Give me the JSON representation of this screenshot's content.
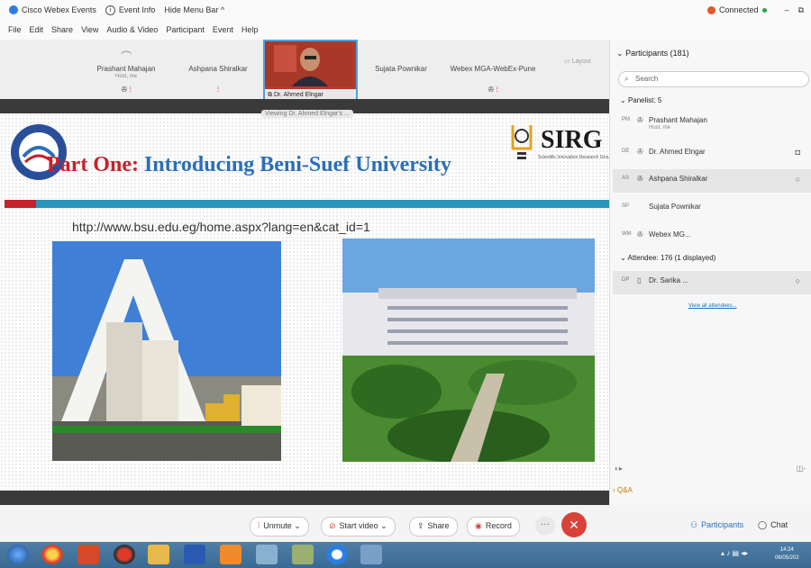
{
  "window": {
    "app_title": "Cisco Webex Events",
    "event_info": "Event Info",
    "hide_menu": "Hide Menu Bar ^",
    "connected": "Connected",
    "min": "–",
    "restore": "⧉"
  },
  "menu": [
    "File",
    "Edit",
    "Share",
    "View",
    "Audio & Video",
    "Participant",
    "Event",
    "Help"
  ],
  "video_strip": {
    "tiles": [
      {
        "name": "Prashant Mahajan",
        "sub": "Host, me"
      },
      {
        "name": "Ashpana Shiralkar",
        "sub": ""
      },
      {
        "name": "Dr. Ahmed Elngar",
        "sub": ""
      },
      {
        "name": "Sujata Pownikar",
        "sub": ""
      },
      {
        "name": "Webex MGA-WebEx-Pune",
        "sub": ""
      }
    ],
    "layout_label": "Layout"
  },
  "share": {
    "viewing": "Viewing Dr. Ahmed Elngar's ..."
  },
  "slide": {
    "title_part1": "Part One:",
    "title_part2": " Introducing Beni-Suef University",
    "sirg": "SIRG",
    "sirg_sub": "Scientific Innovation Research Group",
    "url": "http://www.bsu.edu.eg/home.aspx?lang=en&cat_id=1"
  },
  "panel": {
    "header": "Participants (181)",
    "search_placeholder": "Search",
    "panelists_label": "Panelist: 5",
    "panelists": [
      {
        "initials": "PM",
        "name": "Prashant Mahajan",
        "role": "Host, me"
      },
      {
        "initials": "DE",
        "name": "Dr. Ahmed Elngar",
        "role": ""
      },
      {
        "initials": "AS",
        "name": "Ashpana Shiralkar",
        "role": ""
      },
      {
        "initials": "SP",
        "name": "Sujata Pownikar",
        "role": ""
      },
      {
        "initials": "WM",
        "name": "Webex MG...",
        "role": ""
      }
    ],
    "attendees_label": "Attendee: 176 (1 displayed)",
    "attendees": [
      {
        "initials": "DP",
        "name": "Dr. Sarika ...",
        "role": ""
      }
    ],
    "view_all": "View all attendees...",
    "qa": "Q&A"
  },
  "controls": {
    "unmute": "Unmute",
    "start_video": "Start video",
    "share": "Share",
    "record": "Record",
    "more": "···",
    "participants": "Participants",
    "chat": "Chat"
  },
  "taskbar": {
    "time": "14:24",
    "date": "06/05/202"
  },
  "colors": {
    "accent": "#2a7de1",
    "mute_red": "#d8423a",
    "slide_title_blue": "#2a6fb8",
    "slide_title_red": "#c4232b",
    "teal_stripe": "#2a95b8"
  }
}
